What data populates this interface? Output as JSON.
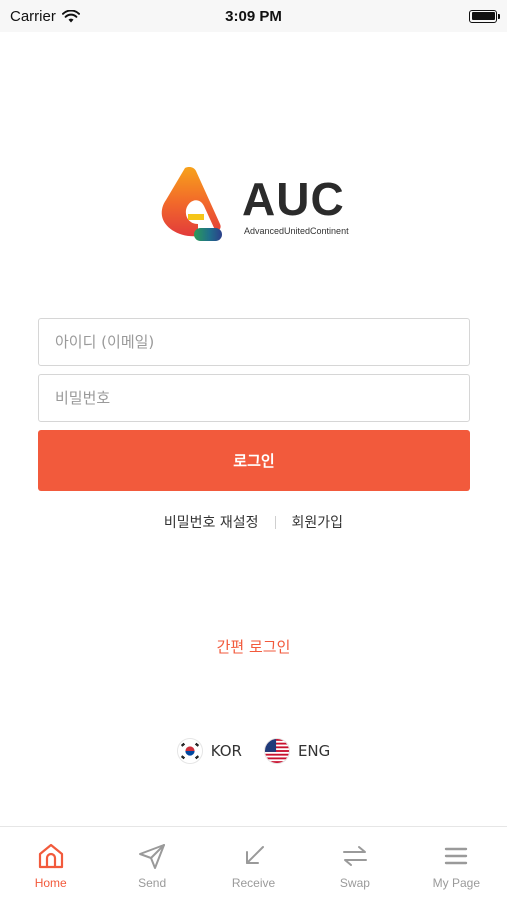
{
  "status_bar": {
    "carrier": "Carrier",
    "time": "3:09 PM"
  },
  "logo": {
    "name": "AUC",
    "tagline": "AdvancedUnitedContinent"
  },
  "login_form": {
    "id_placeholder": "아이디 (이메일)",
    "password_placeholder": "비밀번호",
    "submit_label": "로그인"
  },
  "links": {
    "reset_password": "비밀번호 재설정",
    "sign_up": "회원가입"
  },
  "simple_login": "간편 로그인",
  "languages": [
    {
      "code": "KOR",
      "flag": "korea-flag-icon"
    },
    {
      "code": "ENG",
      "flag": "usa-flag-icon"
    }
  ],
  "tabbar": [
    {
      "label": "Home",
      "icon": "home-icon",
      "active": true
    },
    {
      "label": "Send",
      "icon": "send-icon",
      "active": false
    },
    {
      "label": "Receive",
      "icon": "receive-icon",
      "active": false
    },
    {
      "label": "Swap",
      "icon": "swap-icon",
      "active": false
    },
    {
      "label": "My Page",
      "icon": "menu-icon",
      "active": false
    }
  ],
  "colors": {
    "accent": "#f25a3c",
    "inactive": "#9a9a9a"
  }
}
